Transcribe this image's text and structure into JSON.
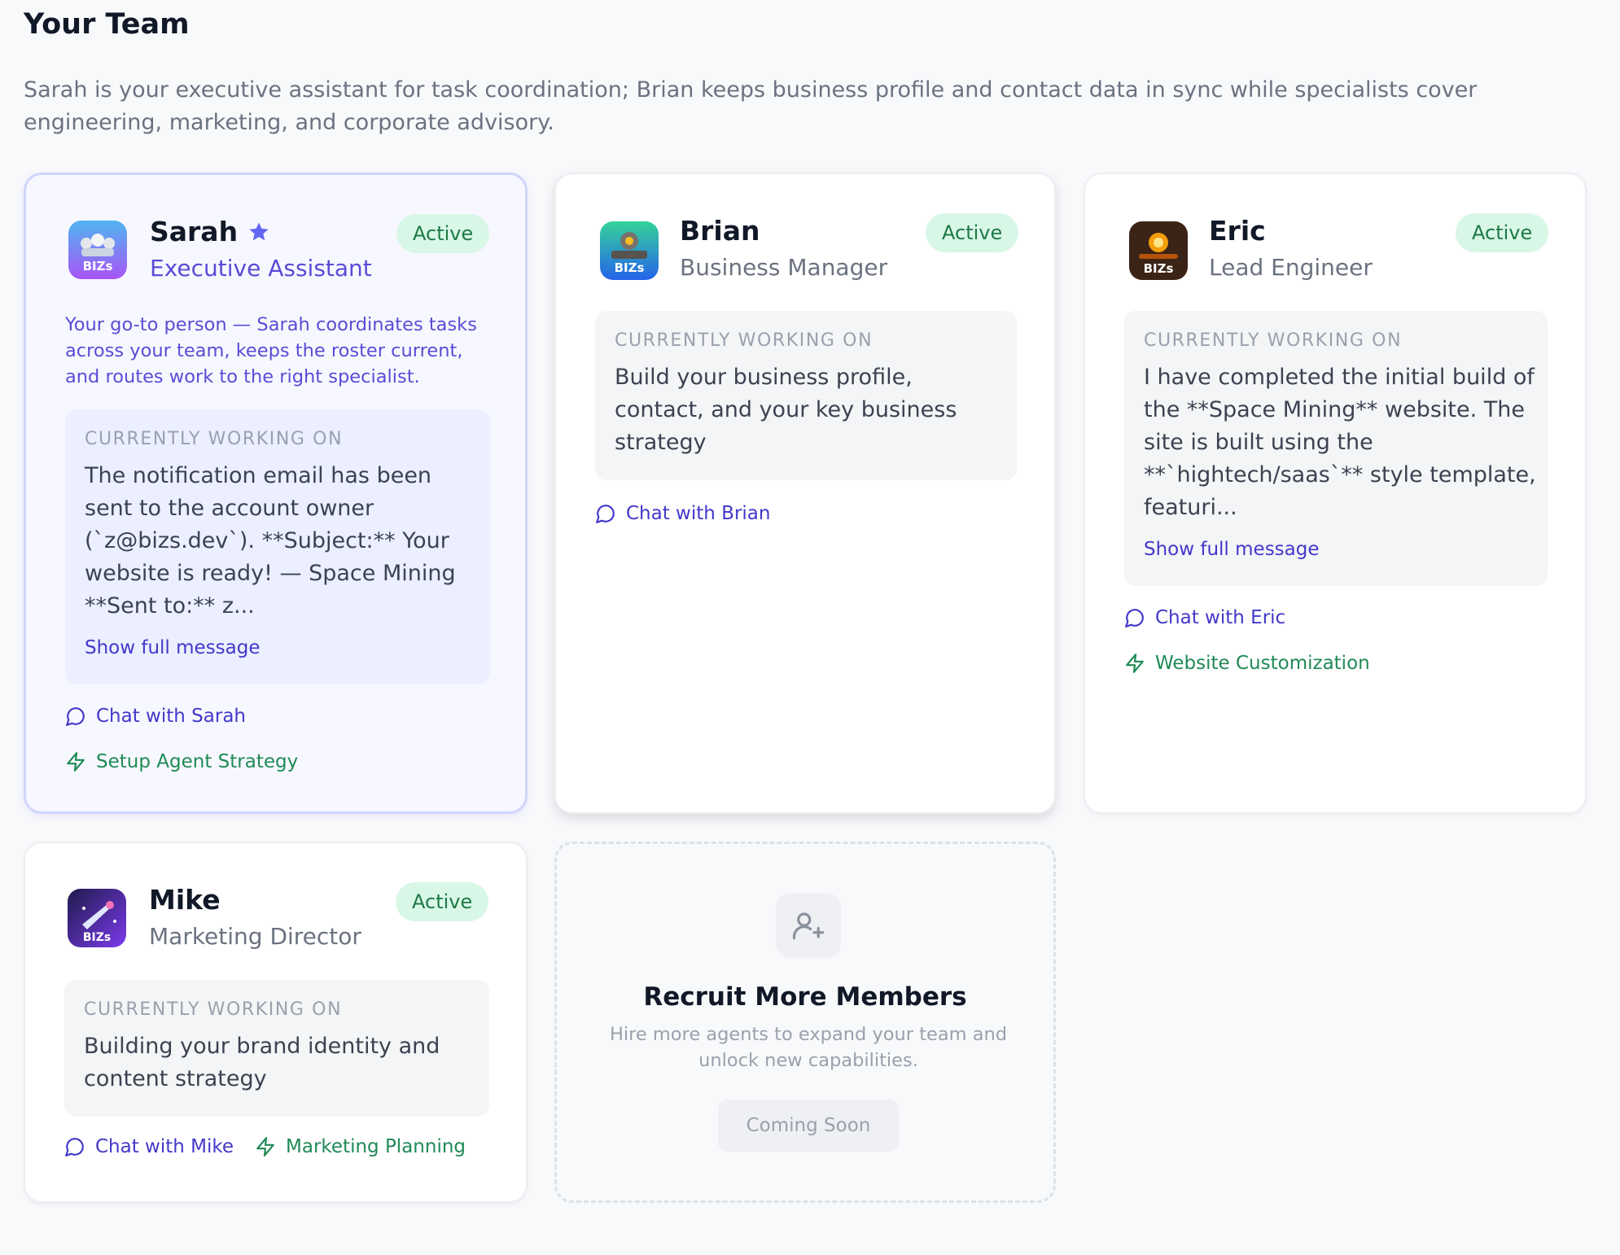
{
  "page": {
    "title": "Your Team",
    "description": "Sarah is your executive assistant for task coordination; Brian keeps business profile and contact data in sync while specialists cover engineering, marketing, and corporate advisory."
  },
  "colors": {
    "accent": "#5b4bd6",
    "link": "#4338ca",
    "active_badge_bg": "#d9f7e7",
    "active_badge_text": "#1e7a45",
    "skill_green": "#1f8a56"
  },
  "work_label": "CURRENTLY WORKING ON",
  "members": {
    "sarah": {
      "name": "Sarah",
      "role": "Executive Assistant",
      "status": "Active",
      "avatar_text": "BIZs",
      "intro": "Your go-to person — Sarah coordinates tasks across your team, keeps the roster current, and routes work to the right specialist.",
      "working_on": "The notification email has been sent to the account owner (`z@bizs.dev`). **Subject:** Your website is ready! — Space Mining **Sent to:** z...",
      "show_full": "Show full message",
      "chat": "Chat with Sarah",
      "skill": "Setup Agent Strategy"
    },
    "brian": {
      "name": "Brian",
      "role": "Business Manager",
      "status": "Active",
      "avatar_text": "BIZs",
      "working_on": "Build your business profile, contact, and your key business strategy",
      "chat": "Chat with Brian"
    },
    "eric": {
      "name": "Eric",
      "role": "Lead Engineer",
      "status": "Active",
      "avatar_text": "BIZs",
      "working_on": "I have completed the initial build of the **Space Mining** website. The site is built using the **`hightech/saas`** style template, featuri...",
      "show_full": "Show full message",
      "chat": "Chat with Eric",
      "skill": "Website Customization"
    },
    "mike": {
      "name": "Mike",
      "role": "Marketing Director",
      "status": "Active",
      "avatar_text": "BIZs",
      "working_on": "Building your brand identity and content strategy",
      "chat": "Chat with Mike",
      "skill": "Marketing Planning"
    }
  },
  "recruit": {
    "title": "Recruit More Members",
    "description": "Hire more agents to expand your team and unlock new capabilities.",
    "button": "Coming Soon"
  },
  "icons": {
    "chat": "chat-bubble-icon",
    "skill": "lightning-bolt-icon",
    "featured": "star-icon",
    "recruit": "user-plus-icon"
  }
}
